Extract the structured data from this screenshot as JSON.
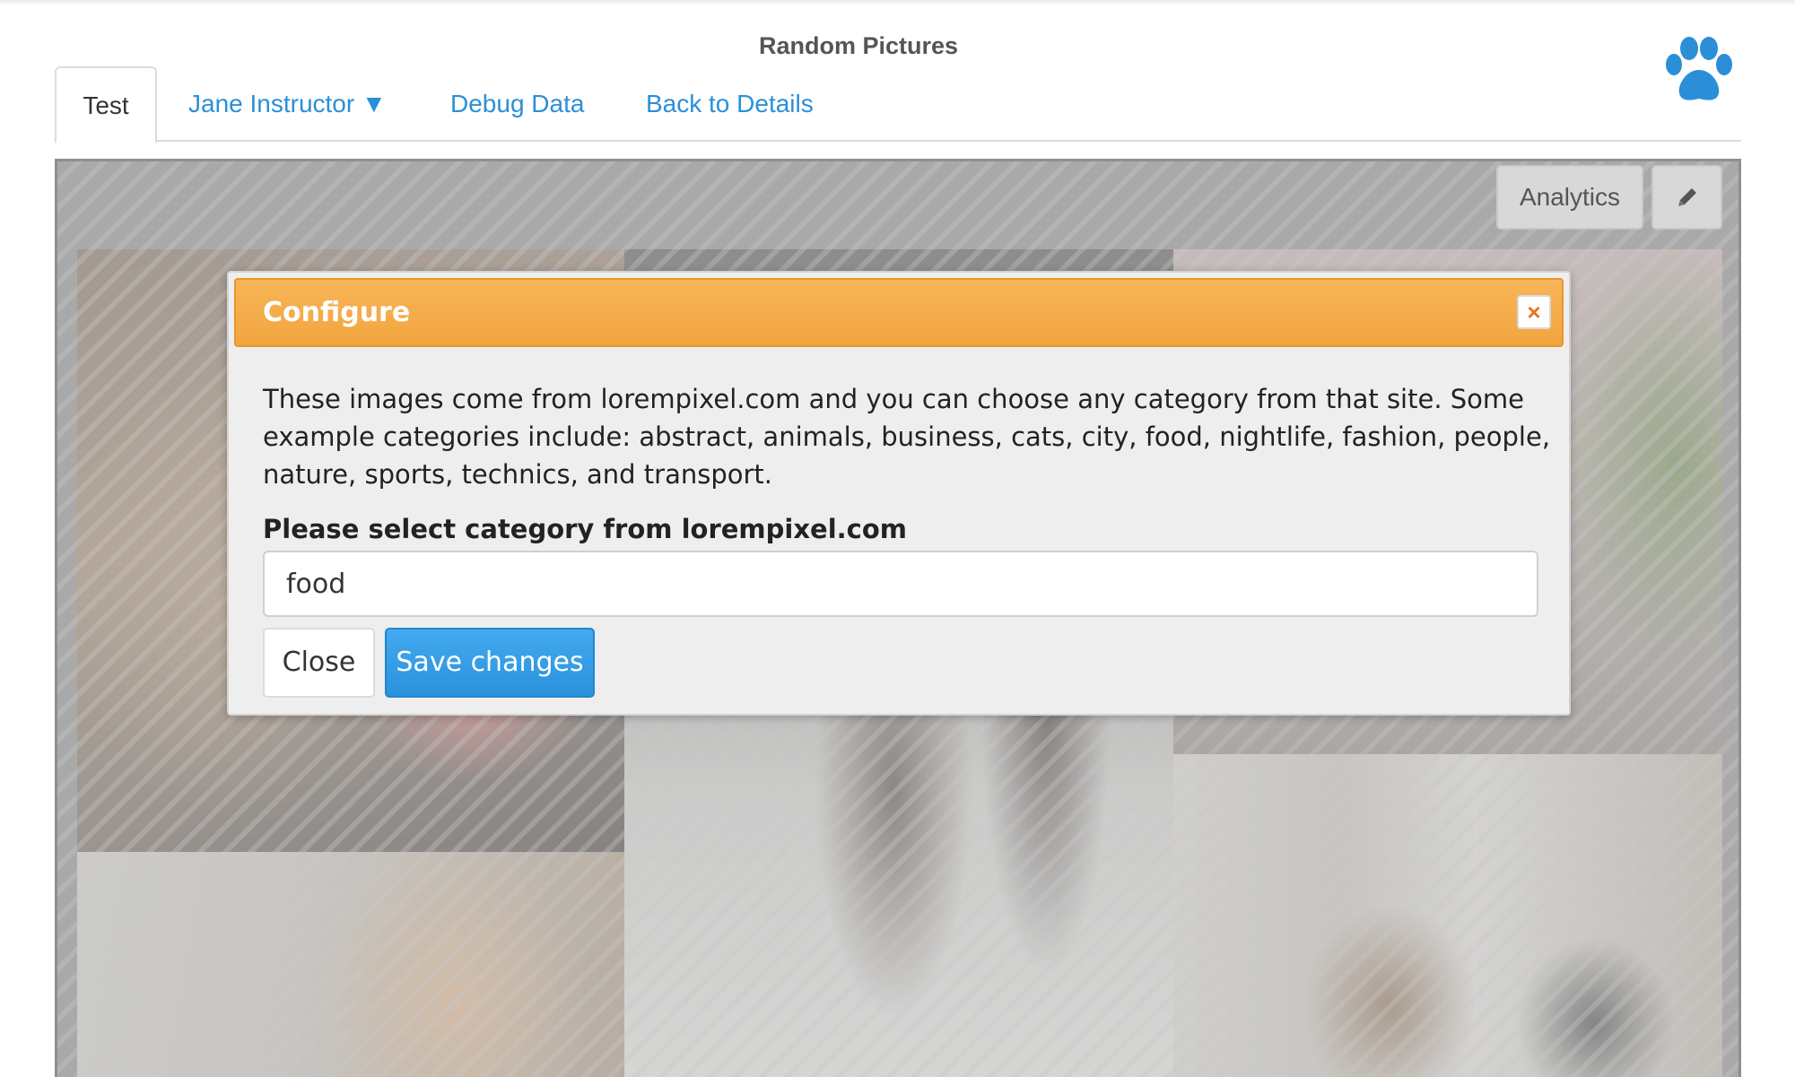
{
  "header": {
    "title": "Random Pictures"
  },
  "tabs": [
    {
      "label": "Test",
      "active": true
    },
    {
      "label": "Jane Instructor ▼",
      "active": false
    },
    {
      "label": "Debug Data",
      "active": false
    },
    {
      "label": "Back to Details",
      "active": false
    }
  ],
  "toolbar": {
    "analytics_label": "Analytics"
  },
  "modal": {
    "title": "Configure",
    "close_icon": "×",
    "description": "These images come from lorempixel.com and you can choose any category from that site. Some example categories include: abstract, animals, business, cats, city, food, nightlife, fashion, people, nature, sports, technics, and transport.",
    "field_label": "Please select category from lorempixel.com",
    "category_value": "food",
    "close_label": "Close",
    "save_label": "Save changes"
  },
  "colors": {
    "link": "#2b8fd8",
    "modal_header": "#f2a53e",
    "primary_button": "#2a92dd",
    "paw_icon": "#2b8fd8"
  },
  "icons": {
    "logo": "paw-icon",
    "edit": "pencil-icon",
    "close": "close-icon"
  }
}
